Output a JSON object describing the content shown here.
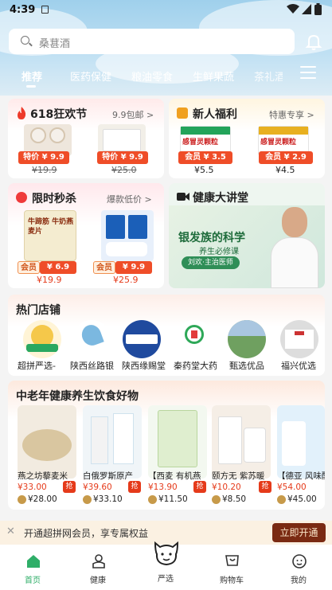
{
  "status_bar": {
    "time": "4:39"
  },
  "search": {
    "placeholder": "桑葚酒"
  },
  "tabs": [
    {
      "label": "推荐",
      "active": true
    },
    {
      "label": "医药保健"
    },
    {
      "label": "粮油零食"
    },
    {
      "label": "生鲜果蔬"
    },
    {
      "label": "茶礼酒"
    }
  ],
  "promo": {
    "festival": {
      "title": "618狂欢节",
      "more": "9.9包邮 >",
      "items": [
        {
          "badge": "特价 ¥ 9.9",
          "orig": "¥19.9"
        },
        {
          "badge": "特价 ¥ 9.9",
          "orig": "¥25.0"
        }
      ]
    },
    "newuser": {
      "title": "新人福利",
      "more": "特惠专享 >",
      "items": [
        {
          "box": "感冒灵颗粒",
          "badge": "会员 ¥ 3.5",
          "price": "¥5.5"
        },
        {
          "box": "感冒灵颗粒",
          "badge": "会员 ¥ 2.9",
          "price": "¥4.5"
        }
      ]
    },
    "flash": {
      "title": "限时秒杀",
      "more": "爆款低价 >",
      "items": [
        {
          "box": "牛蹄筋 牛奶燕麦片",
          "badge_label": "会员",
          "badge_price": "¥ 6.9",
          "price": "¥19.9"
        },
        {
          "badge_label": "会员",
          "badge_price": "¥ 9.9",
          "price": "¥25.9"
        }
      ]
    },
    "lecture": {
      "title": "健康大讲堂",
      "headline": "银发族的科学",
      "subtitle": "养生必修课",
      "host": "刘欢·主治医师"
    }
  },
  "shops": {
    "title": "热门店铺",
    "items": [
      {
        "name": "超拼严选-"
      },
      {
        "name": "陕西丝路银"
      },
      {
        "name": "陕西缘赐堂"
      },
      {
        "name": "秦药堂大药"
      },
      {
        "name": "甄选优品"
      },
      {
        "name": "福兴优选"
      }
    ]
  },
  "health": {
    "title": "中老年健康养生饮食好物",
    "items": [
      {
        "name": "燕之坊藜麦米",
        "price": "¥33.00",
        "member": "¥28.00",
        "qiang": "抢"
      },
      {
        "name": "白俄罗斯原产",
        "price": "¥39.60",
        "member": "¥33.10",
        "qiang": "抢"
      },
      {
        "name": "【西麦 有机燕",
        "price": "¥13.90",
        "member": "¥11.50",
        "qiang": "抢"
      },
      {
        "name": "颐方无 紫苏暖",
        "price": "¥10.20",
        "member": "¥8.50",
        "qiang": "抢"
      },
      {
        "name": "【德亚 风味酸",
        "price": "¥54.00",
        "member": "¥45.00"
      }
    ]
  },
  "vip_bar": {
    "text": "开通超拼网会员，享专属权益",
    "button": "立即开通"
  },
  "bottom_nav": [
    {
      "label": "首页",
      "active": true
    },
    {
      "label": "健康"
    },
    {
      "label": "严选"
    },
    {
      "label": "购物车"
    },
    {
      "label": "我的"
    }
  ],
  "colors": {
    "accent": "#e53a1a",
    "brand_green": "#2fae68",
    "vip_button": "#7a2a12"
  }
}
